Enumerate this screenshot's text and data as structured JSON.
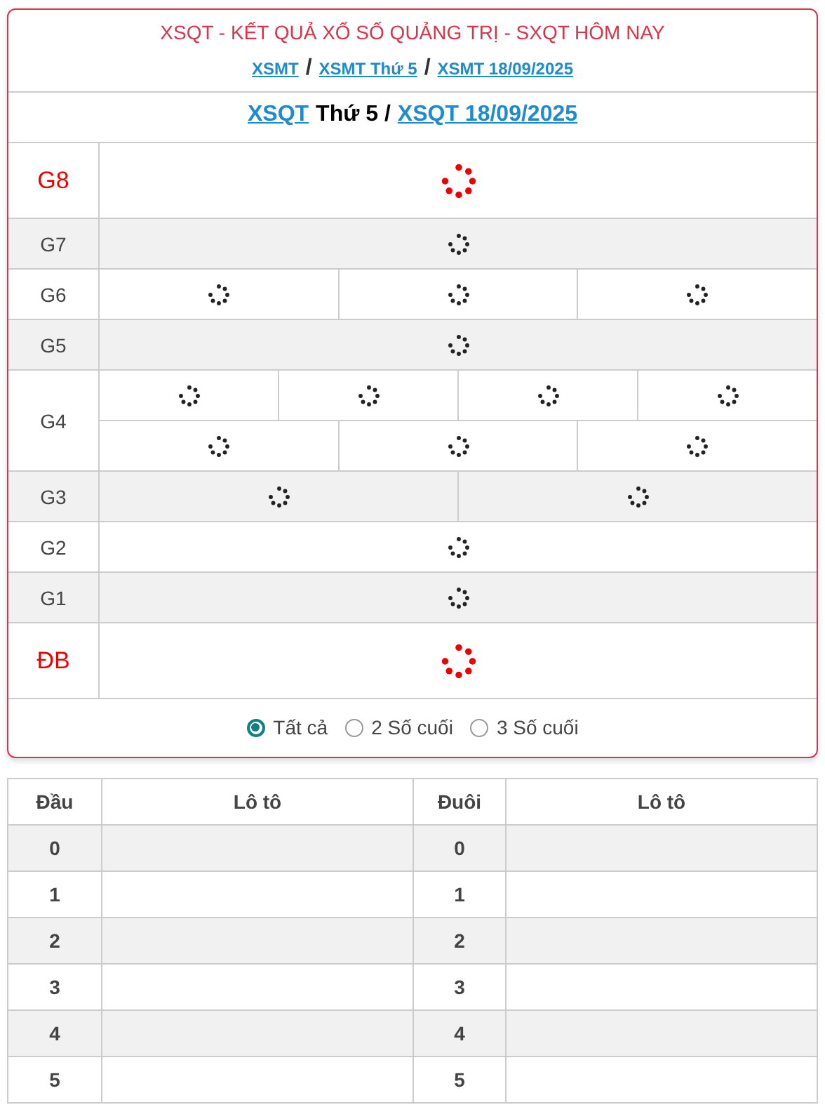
{
  "header": {
    "title": "XSQT - KẾT QUẢ XỔ SỐ QUẢNG TRỊ - SXQT HÔM NAY",
    "breadcrumb": [
      {
        "text": "XSMT",
        "kind": "link"
      },
      {
        "text": "/",
        "kind": "separator"
      },
      {
        "text": "XSMT Thứ 5",
        "kind": "link"
      },
      {
        "text": "/",
        "kind": "separator"
      },
      {
        "text": "XSMT 18/09/2025",
        "kind": "link"
      }
    ],
    "subtitle": [
      {
        "text": "XSQT",
        "kind": "link"
      },
      {
        "text": "Thứ 5 /",
        "kind": "plain"
      },
      {
        "text": "XSQT 18/09/2025",
        "kind": "link"
      }
    ]
  },
  "prizes": [
    {
      "name": "G8",
      "highlight": true,
      "rows": [
        [
          {
            "kind": "loading"
          }
        ]
      ]
    },
    {
      "name": "G7",
      "highlight": false,
      "rows": [
        [
          {
            "kind": "loading"
          }
        ]
      ]
    },
    {
      "name": "G6",
      "highlight": false,
      "rows": [
        [
          {
            "kind": "loading"
          },
          {
            "kind": "loading"
          },
          {
            "kind": "loading"
          }
        ]
      ]
    },
    {
      "name": "G5",
      "highlight": false,
      "rows": [
        [
          {
            "kind": "loading"
          }
        ]
      ]
    },
    {
      "name": "G4",
      "highlight": false,
      "rows": [
        [
          {
            "kind": "loading"
          },
          {
            "kind": "loading"
          },
          {
            "kind": "loading"
          },
          {
            "kind": "loading"
          }
        ],
        [
          {
            "kind": "loading"
          },
          {
            "kind": "loading"
          },
          {
            "kind": "loading"
          }
        ]
      ]
    },
    {
      "name": "G3",
      "highlight": false,
      "rows": [
        [
          {
            "kind": "loading"
          },
          {
            "kind": "loading"
          }
        ]
      ]
    },
    {
      "name": "G2",
      "highlight": false,
      "rows": [
        [
          {
            "kind": "loading"
          }
        ]
      ]
    },
    {
      "name": "G1",
      "highlight": false,
      "rows": [
        [
          {
            "kind": "loading"
          }
        ]
      ]
    },
    {
      "name": "ĐB",
      "highlight": true,
      "rows": [
        [
          {
            "kind": "loading"
          }
        ]
      ]
    }
  ],
  "filter": [
    {
      "label": "Tất cả",
      "selected": true
    },
    {
      "label": "2 Số cuối",
      "selected": false
    },
    {
      "label": "3 Số cuối",
      "selected": false
    }
  ],
  "loto_table": {
    "columns": [
      "Đầu",
      "Lô tô",
      "Đuôi",
      "Lô tô"
    ],
    "rows": [
      {
        "head": "0",
        "tail": "0"
      },
      {
        "head": "1",
        "tail": "1"
      },
      {
        "head": "2",
        "tail": "2"
      },
      {
        "head": "3",
        "tail": "3"
      },
      {
        "head": "4",
        "tail": "4"
      },
      {
        "head": "5",
        "tail": "5"
      }
    ]
  }
}
